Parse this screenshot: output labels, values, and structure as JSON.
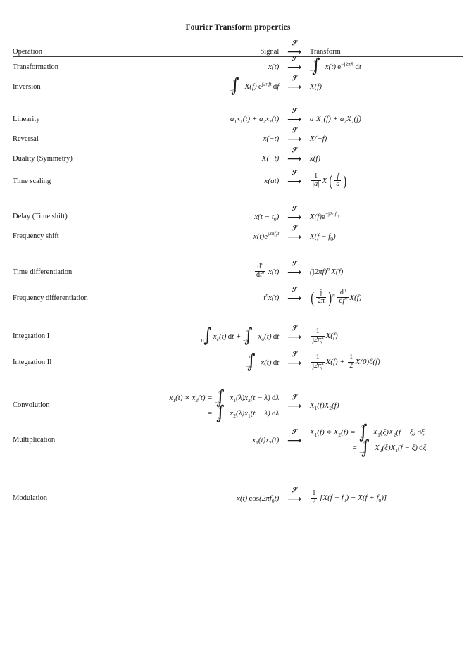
{
  "document": {
    "title": "Fourier Transform properties",
    "transform_symbol": "F",
    "arrow_glyph": "⟶"
  },
  "table": {
    "headers": {
      "operation": "Operation",
      "signal": "Signal",
      "transform": "Transform"
    },
    "rows": [
      {
        "operation": "Transformation",
        "signal_text": "x(t)",
        "transform_text": "∫_{-∞}^{∞} x(t) e^{-j2πft} dt"
      },
      {
        "operation": "Inversion",
        "signal_text": "∫_{-∞}^{∞} X(f) e^{j2πft} df",
        "transform_text": "X(f)"
      },
      {
        "operation": "Linearity",
        "signal_text": "a₁x₁(t) + a₂x₂(t)",
        "transform_text": "a₁X₁(f) + a₂X₂(f)"
      },
      {
        "operation": "Reversal",
        "signal_text": "x(−t)",
        "transform_text": "X(−f)"
      },
      {
        "operation": "Duality (Symmetry)",
        "signal_text": "X(−t)",
        "transform_text": "x(f)"
      },
      {
        "operation": "Time scaling",
        "signal_text": "x(at)",
        "transform_text": "(1/|a|) X(f/a)"
      },
      {
        "operation": "Delay (Time shift)",
        "signal_text": "x(t − t₀)",
        "transform_text": "X(f) e^{-j2πft₀}"
      },
      {
        "operation": "Frequency shift",
        "signal_text": "x(t) e^{j2πf₀t}",
        "transform_text": "X(f − f₀)"
      },
      {
        "operation": "Time differentiation",
        "signal_text": "dⁿ/dtⁿ x(t)",
        "transform_text": "(j2πf)ⁿ X(f)"
      },
      {
        "operation": "Frequency differentiation",
        "signal_text": "tⁿ x(t)",
        "transform_text": "(j/2π)ⁿ dⁿ/dfⁿ X(f)"
      },
      {
        "operation": "Integration I",
        "signal_text": "∫_0^t x_e(t) dt + ∫_{-∞}^{t} x_o(t) dt",
        "transform_text": "1/(j2πf) X(f)"
      },
      {
        "operation": "Integration II",
        "signal_text": "∫_{-∞}^{t} x(t) dt",
        "transform_text": "1/(j2πf) X(f) + ½ X(0)δ(f)"
      },
      {
        "operation": "Convolution",
        "signal_text": "x₁(t) * x₂(t) = ∫_{-∞}^{∞} x₁(λ)x₂(t − λ) dλ  =  ∫_{-∞}^{∞} x₂(λ)x₁(t − λ) dλ",
        "transform_text": "X₁(f)X₂(f)"
      },
      {
        "operation": "Multiplication",
        "signal_text": "x₁(t)x₂(t)",
        "transform_text": "X₁(f) * X₂(f) = ∫_{-∞}^{∞} X₁(ξ)X₂(f − ξ) dξ  =  ∫_{-∞}^{∞} X₂(ξ)X₁(f − ξ) dξ"
      },
      {
        "operation": "Modulation",
        "signal_text": "x(t) cos(2πf₀t)",
        "transform_text": "½ [X(f − f₀) + X(f + f₀)]"
      }
    ]
  }
}
